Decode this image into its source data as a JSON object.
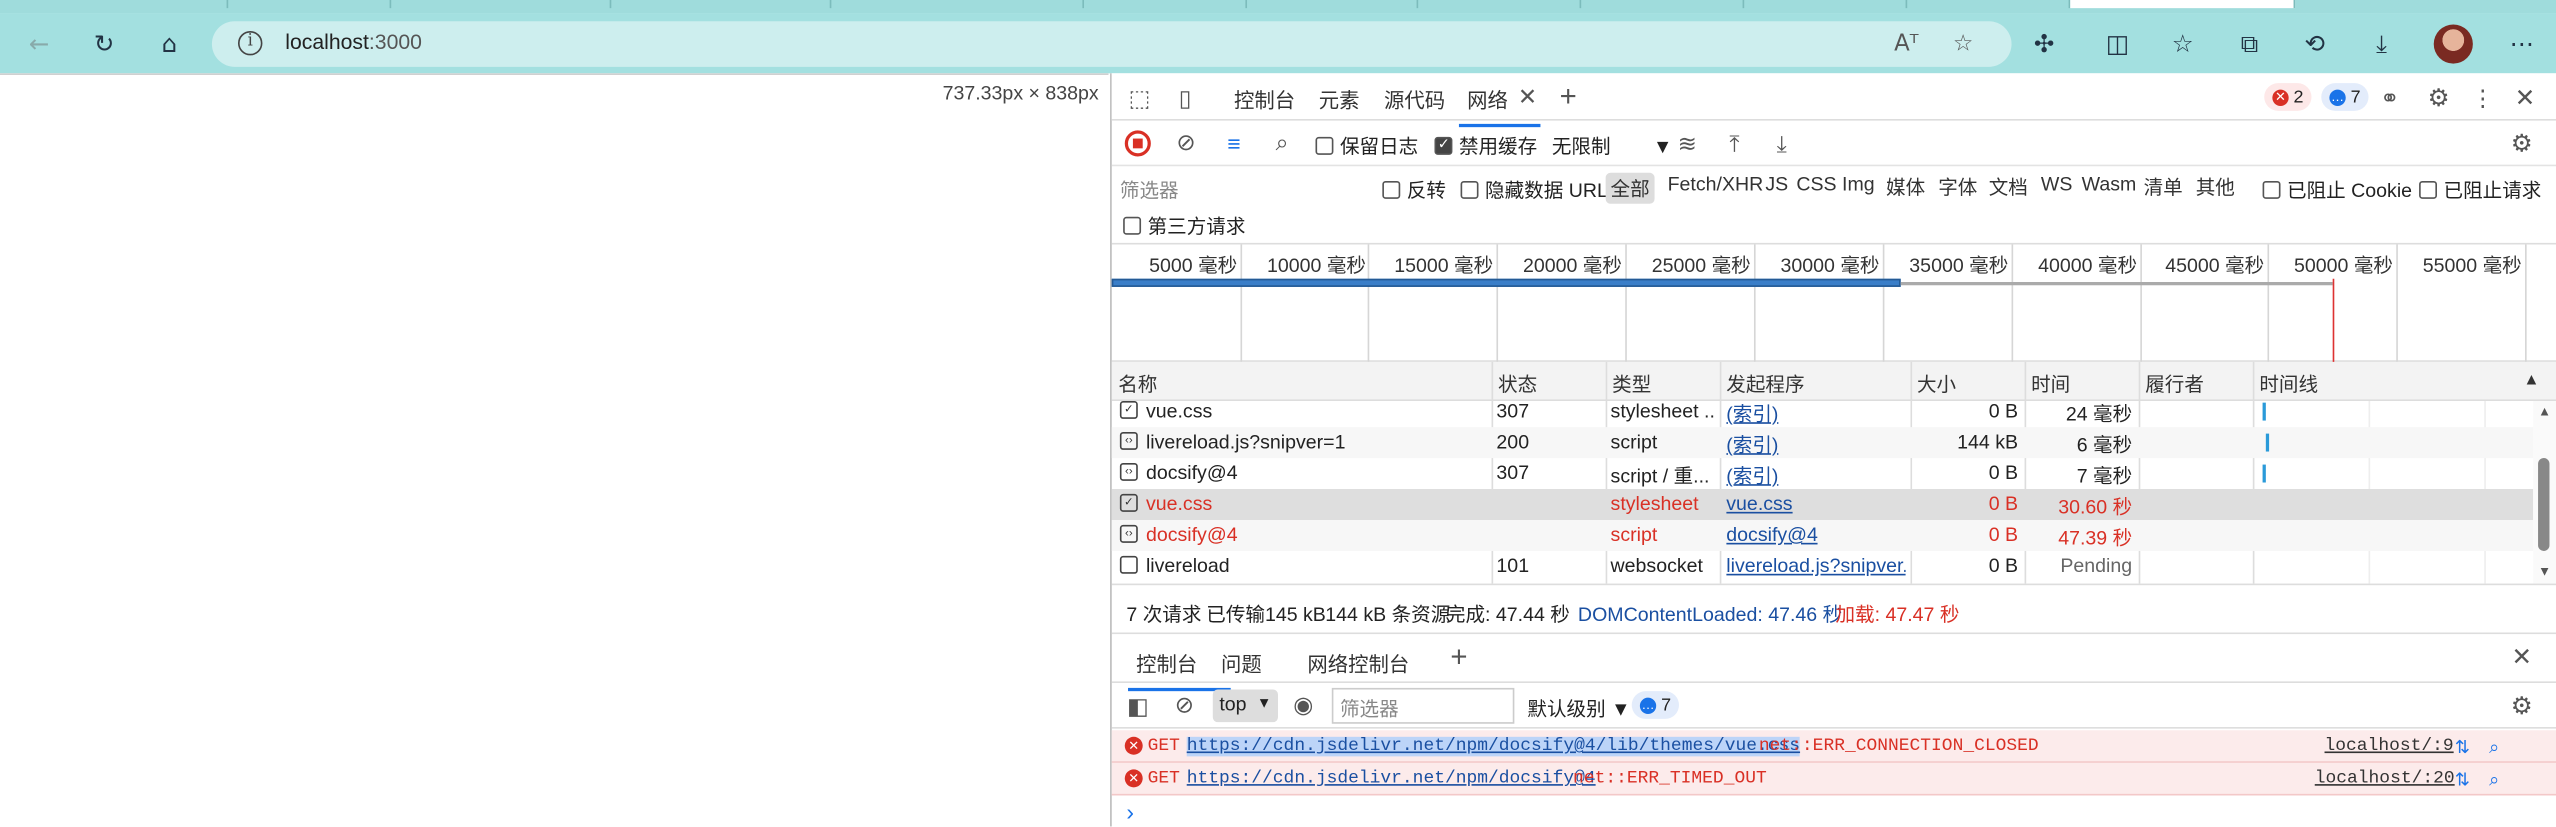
{
  "browser": {
    "url_host": "localhost",
    "url_port": ":3000",
    "read_aloud": "Aᵀ"
  },
  "viewport": {
    "dimensions": "737.33px × 838px"
  },
  "devtools": {
    "tabs": [
      "控制台",
      "元素",
      "源代码",
      "网络"
    ],
    "error_count": "2",
    "message_count": "7",
    "toolbar": {
      "preserve_log": "保留日志",
      "disable_cache": "禁用缓存",
      "throttle": "无限制"
    },
    "filter": {
      "placeholder": "筛选器",
      "invert": "反转",
      "hide_data_url": "隐藏数据 URL",
      "all": "全部",
      "types": [
        "Fetch/XHR",
        "JS",
        "CSS",
        "Img",
        "媒体",
        "字体",
        "文档",
        "WS",
        "Wasm",
        "清单",
        "其他"
      ],
      "blocked_cookie": "已阻止 Cookie",
      "blocked_requests": "已阻止请求",
      "third_party": "第三方请求"
    },
    "timeline_ticks": [
      "5000  毫秒",
      "10000  毫秒",
      "15000  毫秒",
      "20000  毫秒",
      "25000  毫秒",
      "30000  毫秒",
      "35000  毫秒",
      "40000  毫秒",
      "45000  毫秒",
      "50000  毫秒",
      "55000  毫秒"
    ],
    "columns": [
      "名称",
      "状态",
      "类型",
      "发起程序",
      "大小",
      "时间",
      "履行者",
      "时间线"
    ],
    "requests": [
      {
        "name": "vue.css",
        "status": "307",
        "type": "stylesheet ...",
        "initiator": "(索引)",
        "size": "0 B",
        "time": "24  毫秒",
        "error": false
      },
      {
        "name": "livereload.js?snipver=1",
        "status": "200",
        "type": "script",
        "initiator": "(索引)",
        "size": "144 kB",
        "time": "6  毫秒",
        "error": false
      },
      {
        "name": "docsify@4",
        "status": "307",
        "type": "script / 重...",
        "initiator": "(索引)",
        "size": "0 B",
        "time": "7  毫秒",
        "error": false
      },
      {
        "name": "vue.css",
        "status": "",
        "type": "stylesheet",
        "initiator": "vue.css",
        "size": "0 B",
        "time": "30.60 秒",
        "error": true
      },
      {
        "name": "docsify@4",
        "status": "",
        "type": "script",
        "initiator": "docsify@4",
        "size": "0 B",
        "time": "47.39 秒",
        "error": true
      },
      {
        "name": "livereload",
        "status": "101",
        "type": "websocket",
        "initiator": "livereload.js?snipver...",
        "size": "0 B",
        "time": "Pending",
        "error": false
      }
    ],
    "summary": {
      "requests": "7 次请求",
      "transferred": "已传输145 kB",
      "resources": "144 kB 条资源",
      "finish": "完成: 47.44 秒",
      "dcl": "DOMContentLoaded: 47.46 秒",
      "load": "加载: 47.47 秒"
    },
    "drawer_tabs": [
      "控制台",
      "问题",
      "网络控制台"
    ],
    "console": {
      "context": "top",
      "filter_placeholder": "筛选器",
      "level": "默认级别",
      "msg_count": "7",
      "messages": [
        {
          "method": "GET",
          "url": "https://cdn.jsdelivr.net/npm/docsify@4/lib/themes/vue.css",
          "error": "net::ERR_CONNECTION_CLOSED",
          "source": "localhost/:9"
        },
        {
          "method": "GET",
          "url": "https://cdn.jsdelivr.net/npm/docsify@4",
          "error": "net::ERR_TIMED_OUT",
          "source": "localhost/:20"
        }
      ],
      "prompt": "›"
    },
    "colors": {
      "error": "#d93025",
      "accent": "#1a73e8",
      "link": "#1a4fa1",
      "browser_chrome": "#a3e0e0"
    }
  }
}
